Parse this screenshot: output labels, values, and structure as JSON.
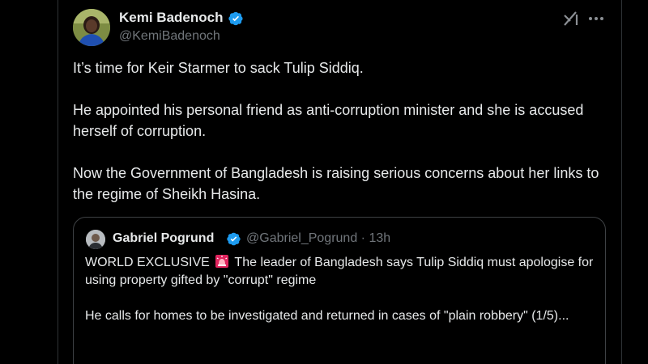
{
  "author": {
    "name": "Kemi Badenoch",
    "handle": "@KemiBadenoch"
  },
  "tweet": {
    "paragraphs": [
      "It’s time for Keir Starmer to sack Tulip Siddiq.",
      "He appointed his personal friend as anti-corruption minister and she is accused herself of corruption.",
      "Now the Government of Bangladesh is raising serious concerns about her links to the regime of Sheikh Hasina."
    ]
  },
  "quote": {
    "name": "Gabriel Pogrund",
    "handle": "@Gabriel_Pogrund",
    "separator": "·",
    "time": "13h",
    "line1_prefix": "WORLD EXCLUSIVE",
    "line1_suffix": " The leader of Bangladesh says Tulip Siddiq must apologise for using property gifted by \"corrupt\" regime",
    "paragraph2": "He calls for homes to be investigated and returned in cases of  \"plain robbery\" (1/5)..."
  },
  "icons": {
    "verified": "verified-badge-icon",
    "grok": "grok-icon",
    "more": "more-options-icon",
    "siren": "rotating-light-icon"
  },
  "colors": {
    "background": "#000000",
    "text_primary": "#e7e9ea",
    "text_secondary": "#71767b",
    "verified_blue": "#1d9bf0",
    "border": "#2f3336",
    "siren_red": "#e0245e"
  }
}
